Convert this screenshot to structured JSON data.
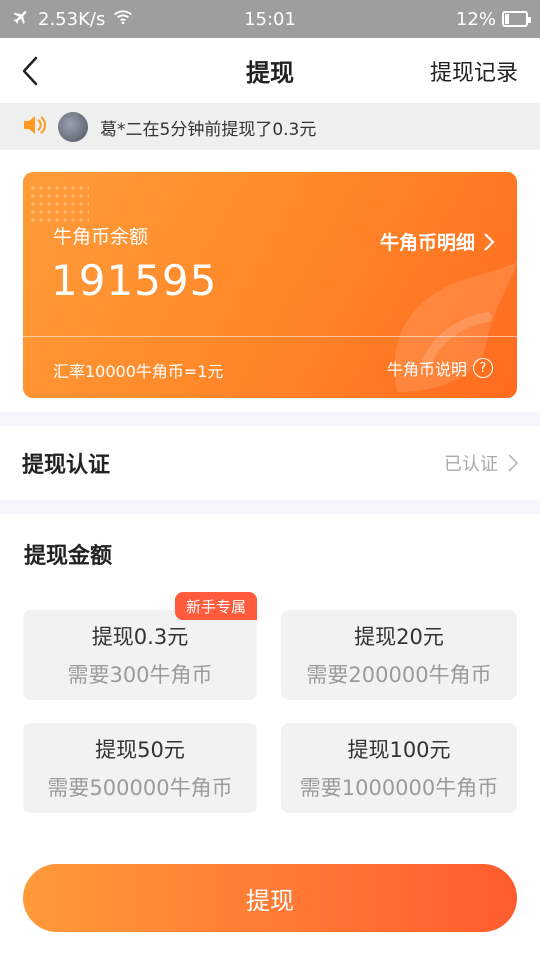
{
  "statusbar": {
    "speed": "2.53K/s",
    "time": "15:01",
    "battery": "12%"
  },
  "nav": {
    "title": "提现",
    "right": "提现记录"
  },
  "notice": {
    "text": "葛*二在5分钟前提现了0.3元"
  },
  "balance": {
    "label": "牛角币余额",
    "value": "191595",
    "detail_link": "牛角币明细",
    "rate": "汇率10000牛角币=1元",
    "explain": "牛角币说明"
  },
  "verify": {
    "label": "提现认证",
    "status": "已认证"
  },
  "amount": {
    "title": "提现金额",
    "options": [
      {
        "label": "提现0.3元",
        "need": "需要300牛角币",
        "badge": "新手专属"
      },
      {
        "label": "提现20元",
        "need": "需要200000牛角币"
      },
      {
        "label": "提现50元",
        "need": "需要500000牛角币"
      },
      {
        "label": "提现100元",
        "need": "需要1000000牛角币"
      }
    ]
  },
  "submit": {
    "label": "提现"
  },
  "colors": {
    "accent": "#ff6b1f",
    "badge": "#ff5b3c"
  }
}
